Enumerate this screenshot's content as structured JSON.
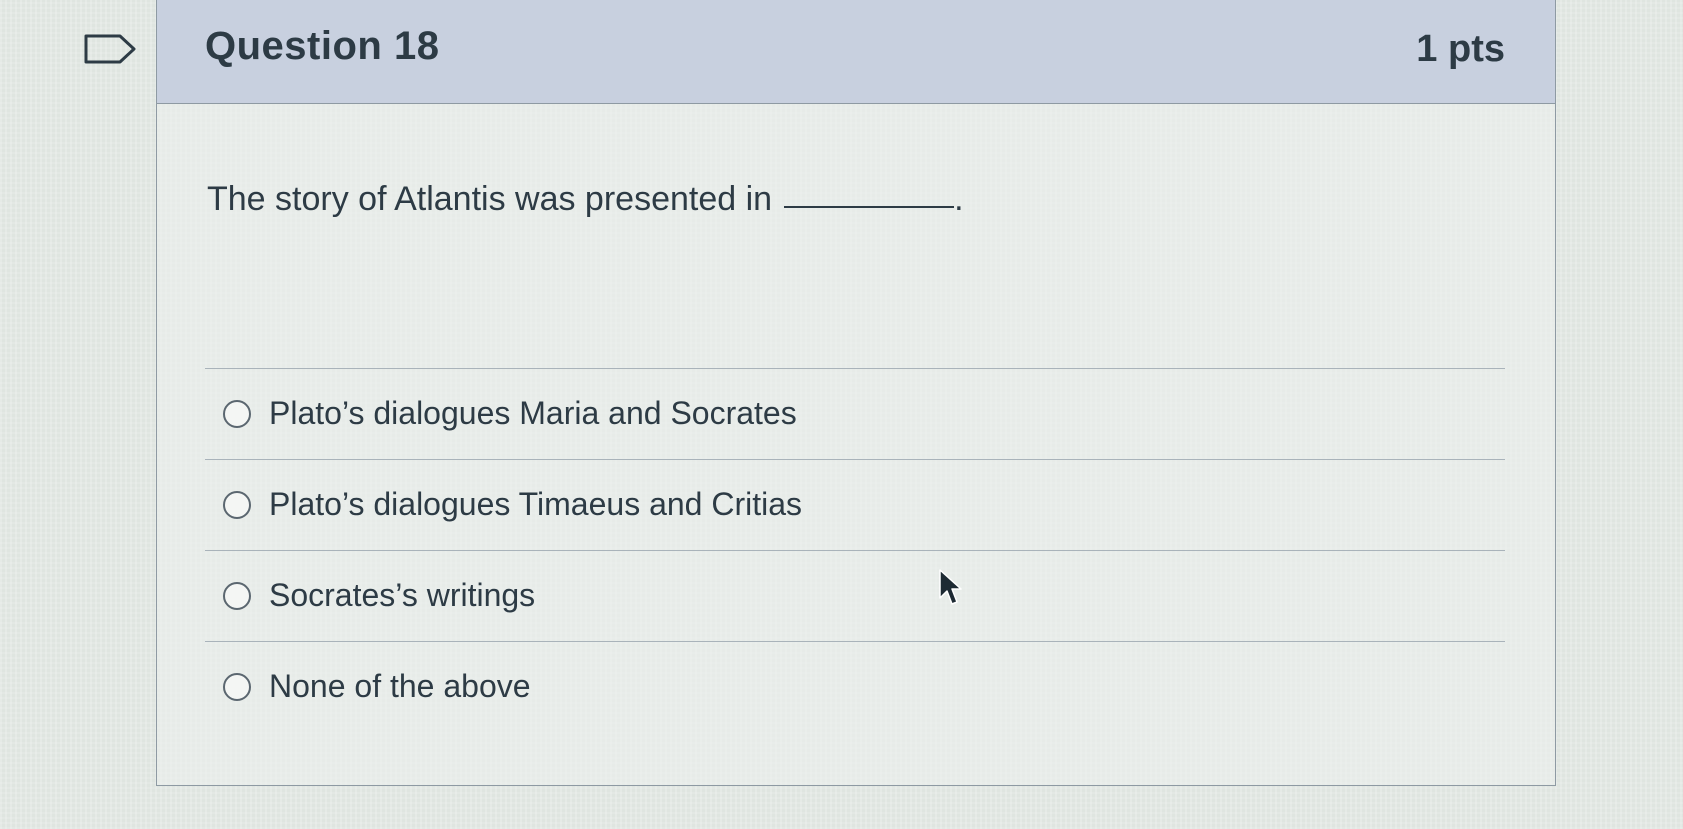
{
  "question": {
    "title": "Question 18",
    "points": "1 pts",
    "text": "The story of Atlantis was presented in",
    "text_end": "."
  },
  "answers": [
    {
      "label": "Plato’s dialogues Maria and Socrates"
    },
    {
      "label": "Plato’s dialogues Timaeus and Critias"
    },
    {
      "label": "Socrates’s writings"
    },
    {
      "label": "None of the above"
    }
  ],
  "icons": {
    "flag": "flag-question-icon",
    "cursor": "mouse-pointer-icon"
  }
}
